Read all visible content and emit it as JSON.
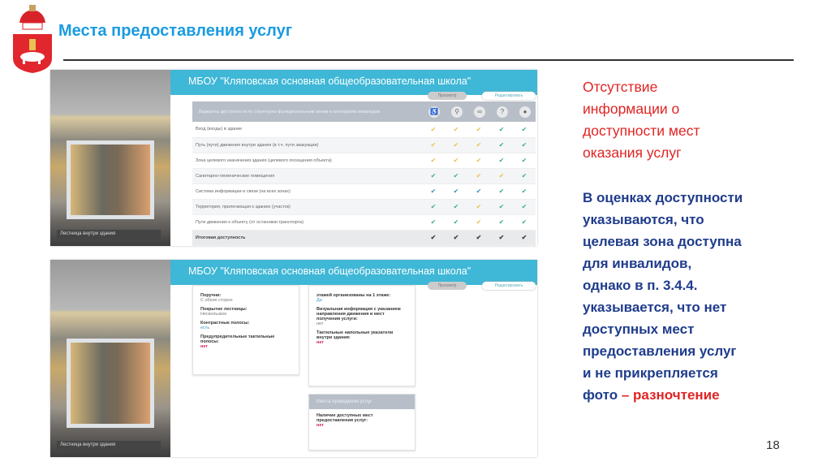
{
  "slide": {
    "title": "Места предоставления услуг",
    "page_number": "18"
  },
  "colors": {
    "title": "#1a9be0",
    "red": "#e02424",
    "blue": "#1f3c8c",
    "header_bar": "#3fb7d6"
  },
  "screenshot1": {
    "header": "МБОУ \"Кляповская основная общеобразовательная школа\"",
    "buttons": [
      "Просмотр",
      "Редактировать"
    ],
    "photo_caption": "Лестница внутри здания",
    "table_header": "Варианты доступности по структурно-функциональным зонам и категориям инвалидов",
    "icons": [
      "wheelchair-icon",
      "cane-icon",
      "glasses-icon",
      "hearing-icon",
      "mind-icon"
    ],
    "rows": [
      {
        "label": "Вход (входы) в здание",
        "marks": [
          "y",
          "y",
          "y",
          "g",
          "g"
        ]
      },
      {
        "label": "Путь (пути) движения внутри здания (в т.ч. пути эвакуации)",
        "marks": [
          "y",
          "y",
          "y",
          "g",
          "g"
        ]
      },
      {
        "label": "Зона целевого назначения здания (целевого посещения объекта)",
        "marks": [
          "y",
          "y",
          "y",
          "g",
          "g"
        ]
      },
      {
        "label": "Санитарно-гигиенические помещения",
        "marks": [
          "g",
          "g",
          "y",
          "y",
          "g"
        ]
      },
      {
        "label": "Система информации и связи (на всех зонах)",
        "marks": [
          "b",
          "b",
          "b",
          "g",
          "g"
        ]
      },
      {
        "label": "Территория, прилегающая к зданию (участок)",
        "marks": [
          "g",
          "g",
          "y",
          "g",
          "g"
        ]
      },
      {
        "label": "Пути движения к объекту (от остановки транспорта)",
        "marks": [
          "g",
          "g",
          "y",
          "g",
          "g"
        ]
      },
      {
        "label": "Итоговая доступность",
        "marks": [
          "y",
          "y",
          "y",
          "y",
          "y"
        ]
      }
    ]
  },
  "screenshot2": {
    "header": "МБОУ \"Кляповская основная общеобразовательная школа\"",
    "buttons": [
      "Просмотр",
      "Редактировать"
    ],
    "photo_caption": "Лестница внутри здания",
    "card1": [
      {
        "label": "Поручни:",
        "value": "С обеих сторон",
        "style": "v"
      },
      {
        "label": "Покрытие лестницы:",
        "value": "Нескользкое",
        "style": "v"
      },
      {
        "label": "Контрастные полосы:",
        "value": "есть",
        "style": "v blue"
      },
      {
        "label": "Предупредительные тактильные полосы:",
        "value": "нет",
        "style": "v red"
      }
    ],
    "card2": [
      {
        "label": "этажей организованы на 1 этаже:",
        "value": "Да",
        "style": "v blue"
      },
      {
        "label": "Визуальная информация с указанием направления движения и мест получения услуги:",
        "value": "нет",
        "style": "v"
      },
      {
        "label": "Тактильные напольные указатели внутри здания:",
        "value": "нет",
        "style": "v red"
      }
    ],
    "card3": {
      "title": "Места проведения услуг",
      "label": "Наличие доступных мест предоставления услуг:",
      "value": "нет"
    }
  },
  "notes": {
    "red_lines": [
      "Отсутствие",
      "информации о",
      "доступности мест",
      "оказания услуг"
    ],
    "blue_lines": [
      "В оценках доступности",
      "указываются, что",
      "целевая зона доступна",
      "для инвалидов,",
      "однако в п. 3.4.4.",
      "указывается, что нет",
      "доступных мест",
      "предоставления услуг",
      "и не прикрепляется",
      "фото "
    ],
    "dash": "–",
    "highlight": "разночтение"
  }
}
